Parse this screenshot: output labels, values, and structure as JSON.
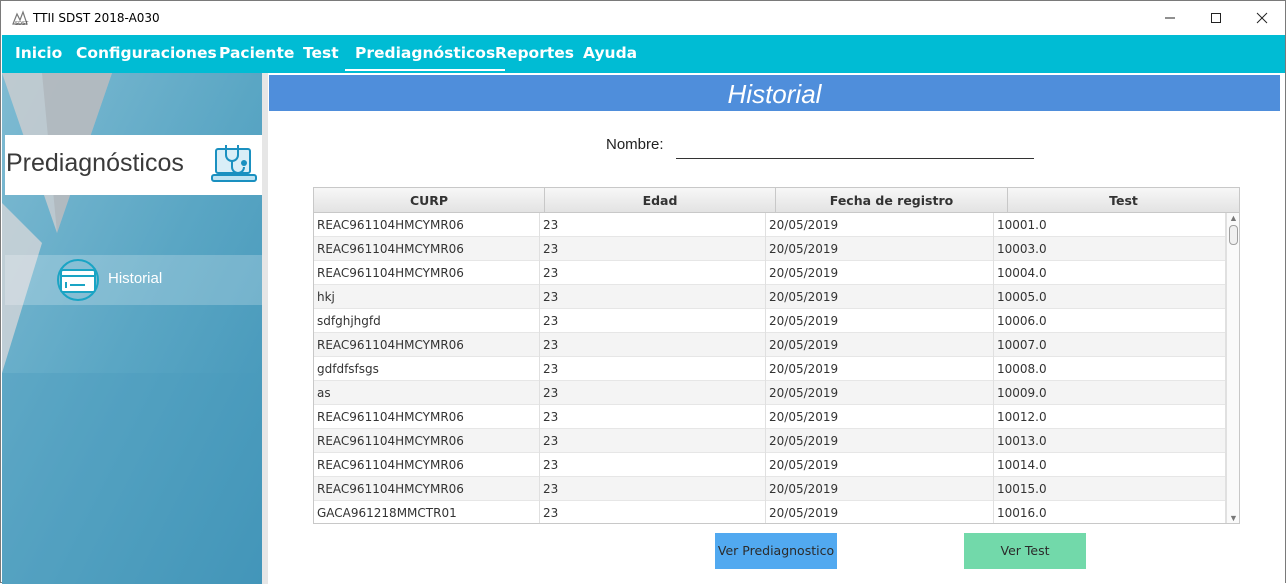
{
  "window": {
    "title": "TTII SDST 2018-A030"
  },
  "menu": {
    "items": [
      {
        "label": "Inicio"
      },
      {
        "label": "Configuraciones"
      },
      {
        "label": "Paciente"
      },
      {
        "label": "Test"
      },
      {
        "label": "Prediagnósticos",
        "active": true
      },
      {
        "label": "Reportes"
      },
      {
        "label": "Ayuda"
      }
    ]
  },
  "sidebar": {
    "header": "Prediagnósticos",
    "header_icon": "laptop-stethoscope-icon",
    "items": [
      {
        "label": "Historial",
        "icon": "history-card-icon"
      }
    ]
  },
  "content": {
    "title": "Historial",
    "name_label": "Nombre:",
    "name_value": ""
  },
  "table": {
    "columns": [
      "CURP",
      "Edad",
      "Fecha de registro",
      "Test"
    ],
    "rows": [
      [
        "REAC961104HMCYMR06",
        "23",
        "20/05/2019",
        "10001.0"
      ],
      [
        "REAC961104HMCYMR06",
        "23",
        "20/05/2019",
        "10003.0"
      ],
      [
        "REAC961104HMCYMR06",
        "23",
        "20/05/2019",
        "10004.0"
      ],
      [
        "hkj",
        "23",
        "20/05/2019",
        "10005.0"
      ],
      [
        "sdfghjhgfd",
        "23",
        "20/05/2019",
        "10006.0"
      ],
      [
        "REAC961104HMCYMR06",
        "23",
        "20/05/2019",
        "10007.0"
      ],
      [
        "gdfdfsfsgs",
        "23",
        "20/05/2019",
        "10008.0"
      ],
      [
        "as",
        "23",
        "20/05/2019",
        "10009.0"
      ],
      [
        "REAC961104HMCYMR06",
        "23",
        "20/05/2019",
        "10012.0"
      ],
      [
        "REAC961104HMCYMR06",
        "23",
        "20/05/2019",
        "10013.0"
      ],
      [
        "REAC961104HMCYMR06",
        "23",
        "20/05/2019",
        "10014.0"
      ],
      [
        "REAC961104HMCYMR06",
        "23",
        "20/05/2019",
        "10015.0"
      ],
      [
        "GACA961218MMCTR01",
        "23",
        "20/05/2019",
        "10016.0"
      ]
    ]
  },
  "buttons": {
    "ver_prediagnostico": "Ver Prediagnostico",
    "ver_test": "Ver Test"
  },
  "colors": {
    "menubar": "#00bcd4",
    "content_header": "#4f8edb",
    "btn_prediagnostico": "#51a9f0",
    "btn_test": "#72d9aa"
  }
}
